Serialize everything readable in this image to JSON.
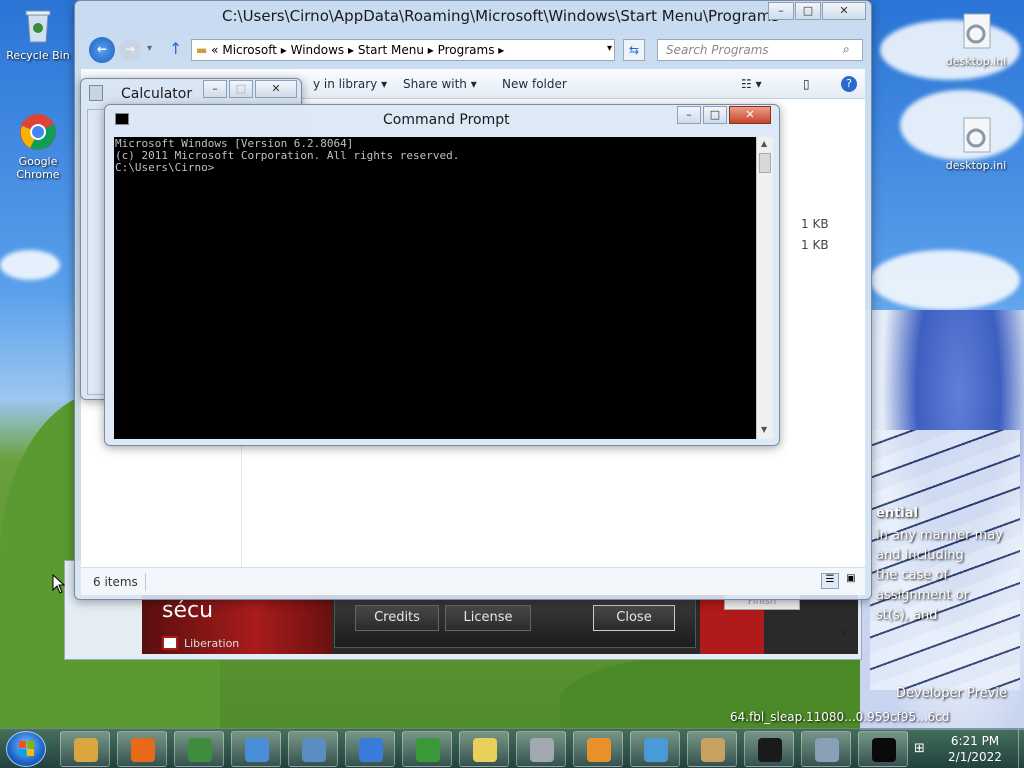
{
  "desktop": {
    "icons": [
      {
        "label": "Recycle Bin",
        "icon": "recycle-bin-icon"
      },
      {
        "label": "Google Chrome",
        "icon": "chrome-icon"
      },
      {
        "label": "desktop.ini",
        "icon": "settings-file-icon"
      },
      {
        "label": "desktop.ini",
        "icon": "settings-file-icon"
      }
    ],
    "overlay_text": {
      "heading": "ential",
      "lines": [
        "in any manner may",
        "and including",
        "the case of",
        "assignment or",
        "st(s), and"
      ],
      "developer": "Developer Previe",
      "build": "64.fbl_sleap.11080...0.959cf95...6cd"
    }
  },
  "explorer": {
    "title": "C:\\Users\\Cirno\\AppData\\Roaming\\Microsoft\\Windows\\Start Menu\\Programs",
    "address": {
      "prefix": "«",
      "segments": [
        "Microsoft",
        "Windows",
        "Start Menu",
        "Programs"
      ]
    },
    "search_placeholder": "Search Programs",
    "toolbar": {
      "include_library": "y in library",
      "share_with": "Share with",
      "new_folder": "New folder"
    },
    "file_sizes": [
      "1 KB",
      "1 KB"
    ],
    "status": "6 items"
  },
  "calculator": {
    "title": "Calculator"
  },
  "command_prompt": {
    "title": "Command Prompt",
    "lines": [
      "Microsoft Windows [Version 6.2.8064]",
      "(c) 2011 Microsoft Corporation. All rights reserved.",
      "",
      "C:\\Users\\Cirno>"
    ]
  },
  "installer": {
    "brand_text": "sécu",
    "brand_sub": "Liberation",
    "buttons": {
      "credits": "Credits",
      "license": "License",
      "close": "Close"
    },
    "finish": "Finish"
  },
  "taskbar": {
    "buttons": [
      {
        "name": "explorer-icon",
        "color": "#d9a640"
      },
      {
        "name": "firefox-icon",
        "color": "#e66a1a"
      },
      {
        "name": "chrome-icon",
        "color": "#3e8e3e"
      },
      {
        "name": "control-panel-icon",
        "color": "#4a8ed8"
      },
      {
        "name": "remote-desktop-icon",
        "color": "#5a8ec0"
      },
      {
        "name": "internet-explorer-icon",
        "color": "#3a7ad8"
      },
      {
        "name": "frog-app-icon",
        "color": "#3a9a3a"
      },
      {
        "name": "chart-app-icon",
        "color": "#e8d05a"
      },
      {
        "name": "printer-fax-icon",
        "color": "#a0a8b0"
      },
      {
        "name": "media-player-icon",
        "color": "#e8902a"
      },
      {
        "name": "paper-plane-icon",
        "color": "#4a9ad8"
      },
      {
        "name": "cat-app-icon",
        "color": "#c8a060"
      },
      {
        "name": "7zip-icon",
        "color": "#1a1a1a"
      },
      {
        "name": "calculator-icon",
        "color": "#8aa0b8"
      },
      {
        "name": "command-prompt-icon",
        "color": "#0a0a0a"
      }
    ],
    "clock": {
      "time": "6:21 PM",
      "date": "2/1/2022"
    }
  }
}
